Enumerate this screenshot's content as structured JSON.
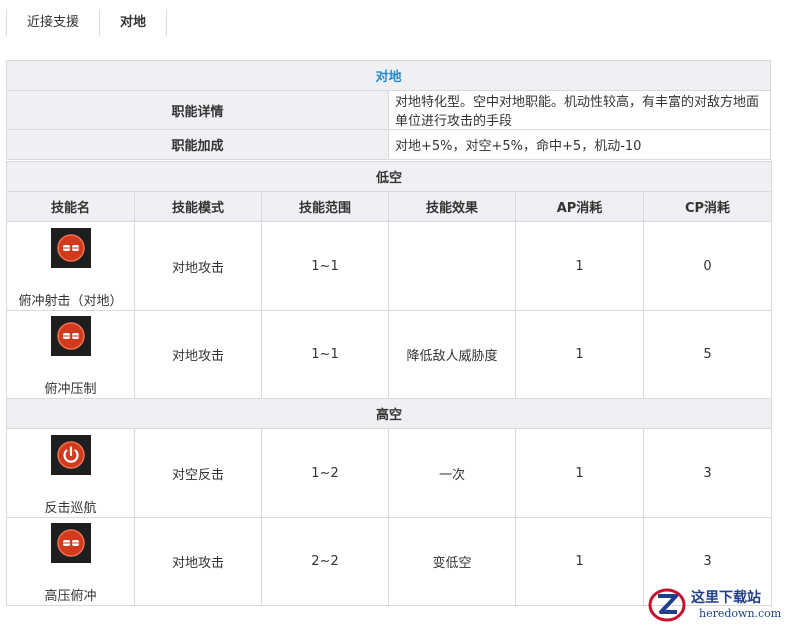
{
  "tabs": [
    {
      "label": "近接支援"
    },
    {
      "label": "对地"
    }
  ],
  "role": {
    "title": "对地",
    "rows": [
      {
        "label": "职能详情",
        "value": "对地特化型。空中对地职能。机动性较高，有丰富的对敌方地面单位进行攻击的手段"
      },
      {
        "label": "职能加成",
        "value": "对地+5%，对空+5%，命中+5，机动-10"
      }
    ]
  },
  "skills": {
    "headers": [
      "技能名",
      "技能模式",
      "技能范围",
      "技能效果",
      "AP消耗",
      "CP消耗"
    ],
    "low": {
      "title": "低空",
      "items": [
        {
          "name": "俯冲射击（对地）",
          "mode": "对地攻击",
          "range": "1~1",
          "effect": "",
          "ap": "1",
          "cp": "0",
          "icon": "bullet-icon"
        },
        {
          "name": "俯冲压制",
          "mode": "对地攻击",
          "range": "1~1",
          "effect": "降低敌人威胁度",
          "ap": "1",
          "cp": "5",
          "icon": "bullet-icon"
        }
      ]
    },
    "high": {
      "title": "高空",
      "items": [
        {
          "name": "反击巡航",
          "mode": "对空反击",
          "range": "1~2",
          "effect": "一次",
          "ap": "1",
          "cp": "3",
          "icon": "power-icon"
        },
        {
          "name": "高压俯冲",
          "mode": "对地攻击",
          "range": "2~2",
          "effect": "变低空",
          "ap": "1",
          "cp": "3",
          "icon": "bullet-icon"
        }
      ]
    }
  },
  "watermark": {
    "line1": "这里下载站",
    "line2": "heredown.com"
  },
  "colors": {
    "accent": "#2a8ac8",
    "header_bg": "#eef0f3",
    "border": "#d9d9d9",
    "icon_red": "#d23a1e"
  }
}
